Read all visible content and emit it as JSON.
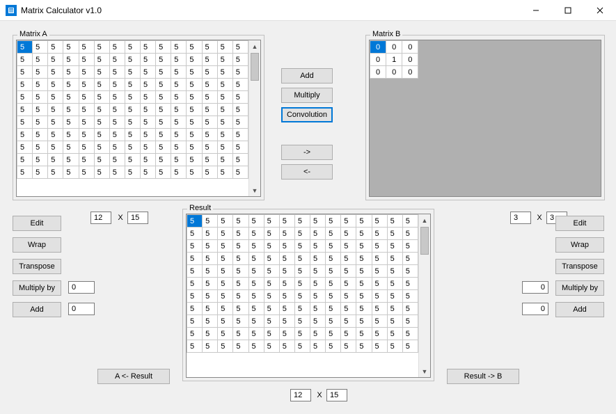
{
  "window": {
    "title": "Matrix Calculator v1.0"
  },
  "matrixA": {
    "legend": "Matrix A",
    "rows_shown": 11,
    "cols": 15,
    "cell_value": "5",
    "dims": {
      "rows": "12",
      "cols": "15",
      "x": "X"
    },
    "buttons": {
      "edit": "Edit",
      "wrap": "Wrap",
      "transpose": "Transpose",
      "multiply_by": "Multiply by",
      "add": "Add"
    },
    "inputs": {
      "multiply_by_val": "0",
      "add_val": "0"
    }
  },
  "matrixB": {
    "legend": "Matrix B",
    "data": [
      [
        "0",
        "0",
        "0"
      ],
      [
        "0",
        "1",
        "0"
      ],
      [
        "0",
        "0",
        "0"
      ]
    ],
    "dims": {
      "rows": "3",
      "cols": "3",
      "x": "X"
    },
    "buttons": {
      "edit": "Edit",
      "wrap": "Wrap",
      "transpose": "Transpose",
      "multiply_by": "Multiply by",
      "add": "Add"
    },
    "inputs": {
      "multiply_by_val": "0",
      "add_val": "0"
    }
  },
  "center": {
    "add": "Add",
    "multiply": "Multiply",
    "convolution": "Convolution",
    "right_arrow": "->",
    "left_arrow": "<-"
  },
  "result": {
    "legend": "Result",
    "rows_shown": 11,
    "cols": 15,
    "cell_value": "5",
    "a_from_result": "A <- Result",
    "result_to_b": "Result -> B",
    "dims": {
      "rows": "12",
      "cols": "15",
      "x": "X"
    }
  }
}
